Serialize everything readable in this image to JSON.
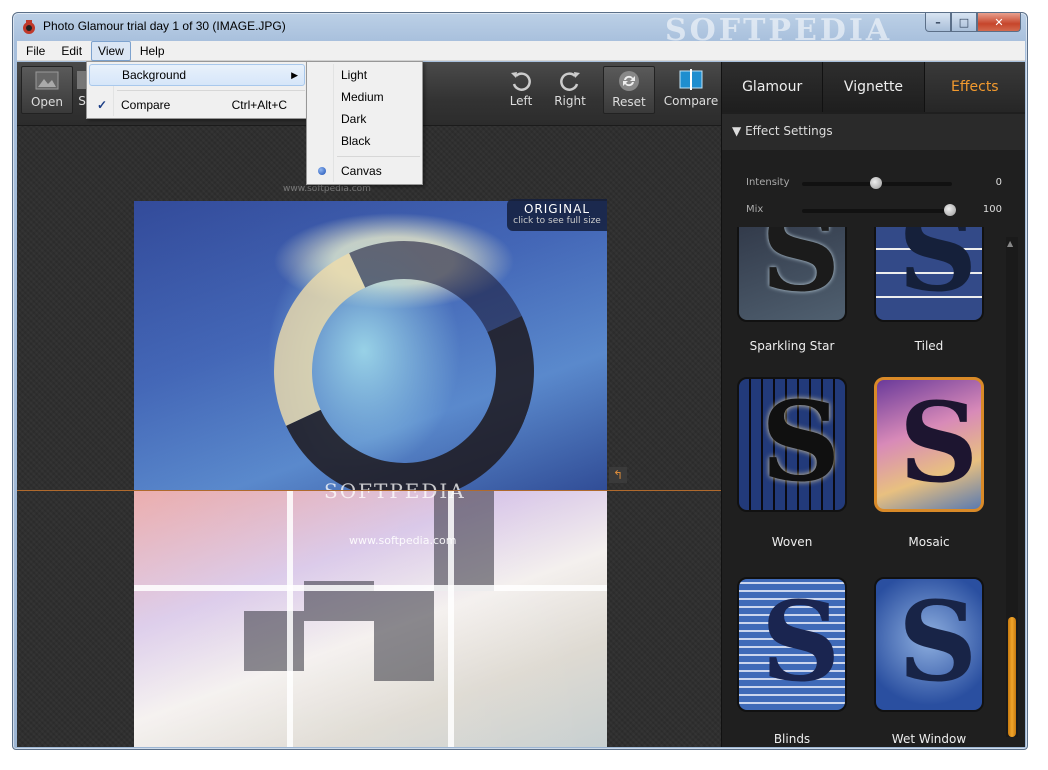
{
  "window": {
    "title": "Photo Glamour trial day 1 of 30 (IMAGE.JPG)",
    "watermark": "SOFTPEDIA",
    "controls": {
      "minimize": "–",
      "maximize": "□",
      "close": "✕"
    }
  },
  "menubar": {
    "items": [
      {
        "label": "File"
      },
      {
        "label": "Edit"
      },
      {
        "label": "View"
      },
      {
        "label": "Help"
      }
    ]
  },
  "view_menu": {
    "background_label": "Background",
    "compare_label": "Compare",
    "compare_shortcut": "Ctrl+Alt+C",
    "compare_checked": true
  },
  "background_menu": {
    "items": [
      {
        "label": "Light"
      },
      {
        "label": "Medium"
      },
      {
        "label": "Dark"
      },
      {
        "label": "Black"
      },
      {
        "label": "Canvas"
      }
    ],
    "selected": "Canvas"
  },
  "toolbar": {
    "open_label": "Open",
    "save_label": "S",
    "left_label": "Left",
    "right_label": "Right",
    "reset_label": "Reset",
    "compare_label": "Compare"
  },
  "canvas": {
    "original_title": "ORIGINAL",
    "original_hint": "click to see full size",
    "watermark_big": "SOFTPEDIA",
    "watermark_url": "www.softpedia.com",
    "watermark_small": "www.softpedia.com"
  },
  "panel": {
    "tabs": [
      {
        "label": "Glamour"
      },
      {
        "label": "Vignette"
      },
      {
        "label": "Effects"
      }
    ],
    "active_tab": "Effects",
    "settings_title": "Effect Settings",
    "intensity_label": "Intensity",
    "intensity_value": "0",
    "mix_label": "Mix",
    "mix_value": "100"
  },
  "effects": [
    {
      "label": "Sparkling Star"
    },
    {
      "label": "Tiled"
    },
    {
      "label": "Woven"
    },
    {
      "label": "Mosaic"
    },
    {
      "label": "Blinds"
    },
    {
      "label": "Wet Window"
    }
  ],
  "selected_effect": "Mosaic",
  "colors": {
    "accent": "#f29a2e",
    "selected_border": "#d98a28"
  }
}
